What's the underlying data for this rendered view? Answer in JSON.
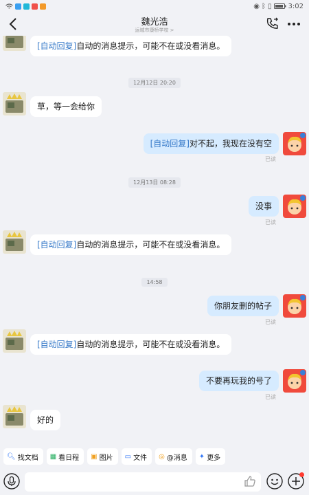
{
  "status_bar": {
    "time": "3:02"
  },
  "header": {
    "title": "魏光浩",
    "subtitle": "运城市康桥学校 >"
  },
  "messages": [
    {
      "side": "left",
      "tag": "[自动回复]",
      "text": "自动的消息提示，可能不在或没看消息。"
    },
    {
      "type": "time",
      "text": "12月12日 20:20"
    },
    {
      "side": "left",
      "text": "草，等一会给你"
    },
    {
      "side": "right",
      "tag": "[自动回复]",
      "text": "对不起，我现在没有空",
      "read": "已读"
    },
    {
      "type": "time",
      "text": "12月13日 08:28"
    },
    {
      "side": "right",
      "text": "没事",
      "read": "已读"
    },
    {
      "side": "left",
      "tag": "[自动回复]",
      "text": "自动的消息提示，可能不在或没看消息。"
    },
    {
      "type": "time",
      "text": "14:58"
    },
    {
      "side": "right",
      "text": "你朋友删的帖子",
      "read": "已读"
    },
    {
      "side": "left",
      "tag": "[自动回复]",
      "text": "自动的消息提示，可能不在或没看消息。"
    },
    {
      "side": "right",
      "text": "不要再玩我的号了",
      "read": "已读"
    },
    {
      "side": "left",
      "text": "好的"
    }
  ],
  "quick_actions": [
    {
      "label": "找文档",
      "icon": "search-doc-icon",
      "color": "#3478f6"
    },
    {
      "label": "看日程",
      "icon": "calendar-icon",
      "color": "#27ae60"
    },
    {
      "label": "图片",
      "icon": "image-icon",
      "color": "#f0a020"
    },
    {
      "label": "文件",
      "icon": "folder-icon",
      "color": "#3478f6"
    },
    {
      "label": "@消息",
      "icon": "at-icon",
      "color": "#f0a020"
    },
    {
      "label": "更多",
      "icon": "more-apps-icon",
      "color": "#3478f6"
    }
  ],
  "input": {
    "placeholder": ""
  },
  "colors": {
    "background": "#f1f2f6",
    "bubble_self": "#d6ebff",
    "bubble_other": "#ffffff",
    "tag": "#3478c8"
  }
}
